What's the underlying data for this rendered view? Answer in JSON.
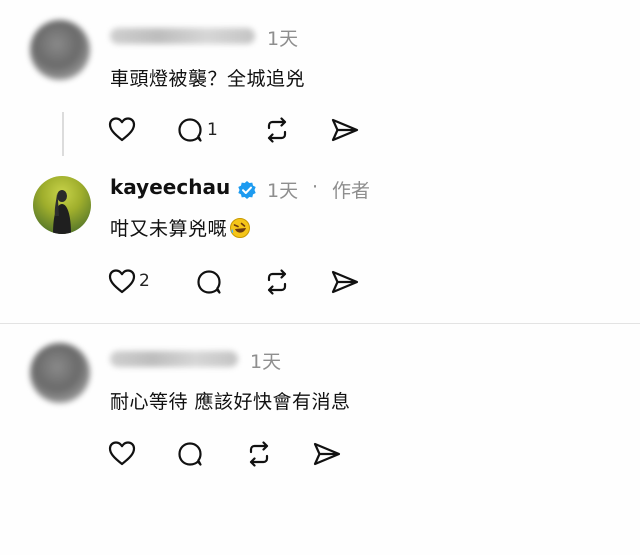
{
  "comments": [
    {
      "timestamp": "1天",
      "text": "車頭燈被襲？全城追兇",
      "reply_count": "1"
    },
    {
      "username": "kayeechau",
      "timestamp": "1天",
      "separator": "·",
      "author_tag": "作者",
      "text": "咁又未算兇嘅",
      "emoji": "rolling-on-floor-laughing",
      "like_count": "2"
    },
    {
      "timestamp": "1天",
      "text": "耐心等待 應該好快會有消息"
    }
  ],
  "colors": {
    "verified": "#1d9bf0",
    "meta": "#8e8e8e",
    "text": "#111111",
    "emoji": "#f5c518"
  }
}
